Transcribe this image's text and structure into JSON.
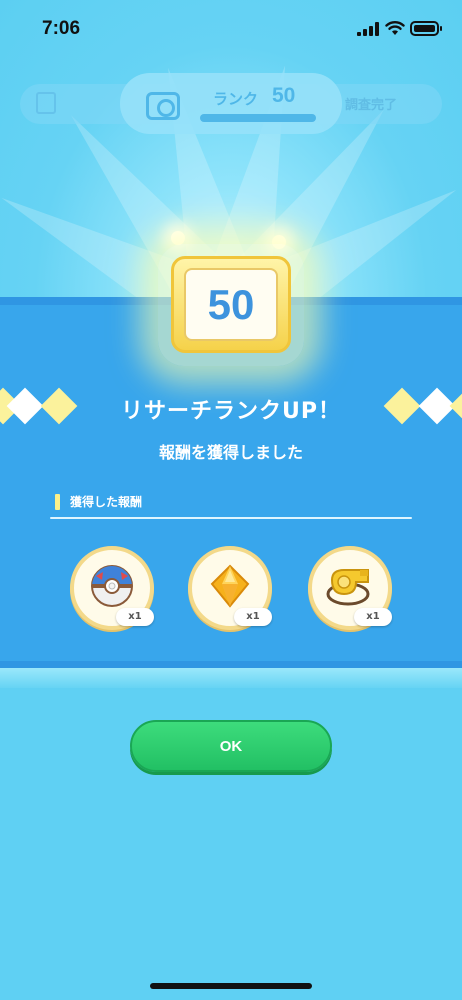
{
  "status_bar": {
    "time": "7:06"
  },
  "background_bar": {
    "left_text": "",
    "right_text": "調査完了"
  },
  "rank": {
    "label": "ランク",
    "value": "50"
  },
  "badge": {
    "value": "50"
  },
  "result": {
    "title": "リサーチランクUP！",
    "subtitle": "報酬を獲得しました"
  },
  "rewards_section": {
    "label": "獲得した報酬",
    "items": [
      {
        "icon": "great-ball-icon",
        "quantity": "x1"
      },
      {
        "icon": "crystal-icon",
        "quantity": "x1"
      },
      {
        "icon": "whistle-icon",
        "quantity": "x1"
      }
    ]
  },
  "ok_button": {
    "label": "OK"
  },
  "colors": {
    "band": "#38a6ec",
    "button": "#2fd06f",
    "badge_number": "#3d93dd",
    "accent_yellow": "#fbf29c"
  }
}
